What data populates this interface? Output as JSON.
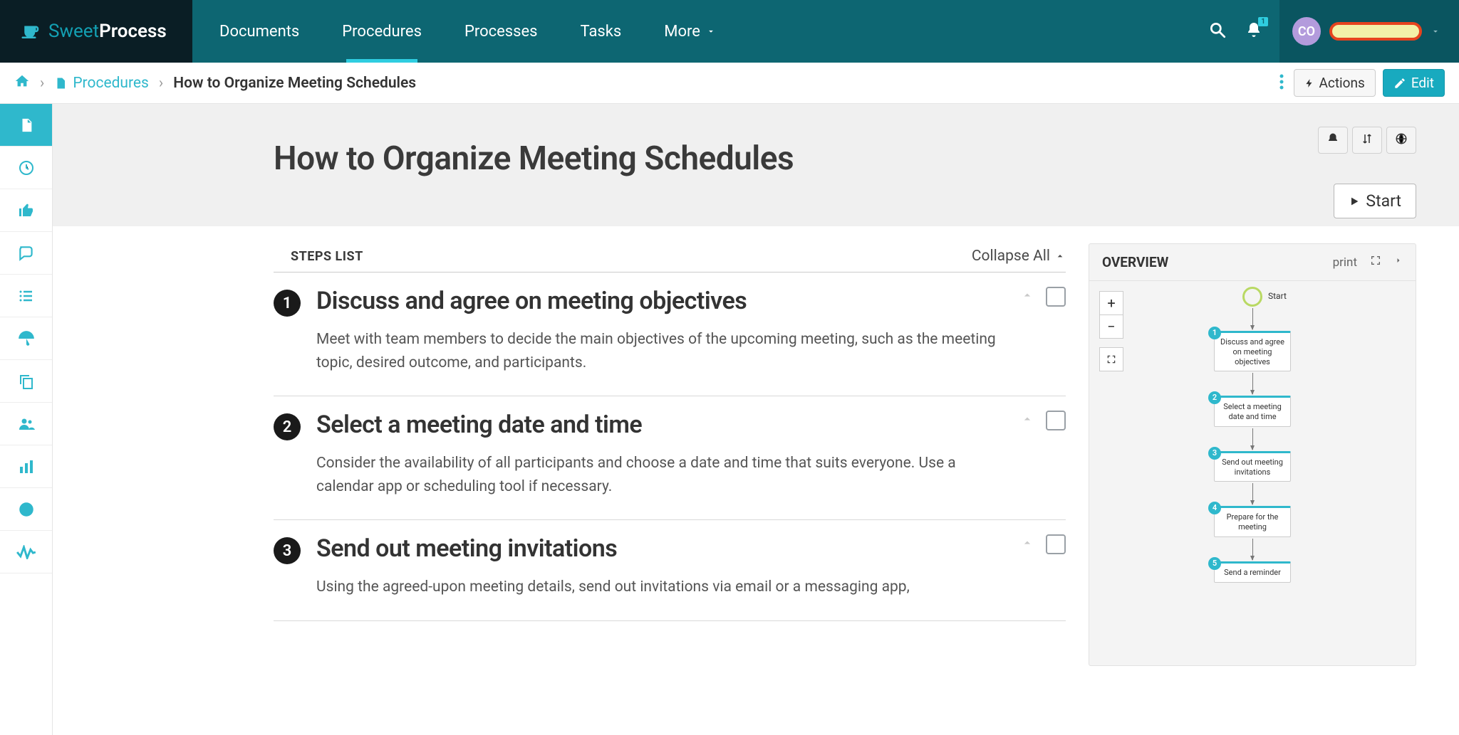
{
  "brand": {
    "name_light": "Sweet",
    "name_bold": "Process"
  },
  "nav": {
    "items": [
      {
        "label": "Documents",
        "active": false
      },
      {
        "label": "Procedures",
        "active": true
      },
      {
        "label": "Processes",
        "active": false
      },
      {
        "label": "Tasks",
        "active": false
      }
    ],
    "more": "More",
    "notification_badge": "1",
    "user_initials": "CO"
  },
  "breadcrumb": {
    "link": "Procedures",
    "current": "How to Organize Meeting Schedules"
  },
  "subheader_buttons": {
    "actions": "Actions",
    "edit": "Edit"
  },
  "hero": {
    "title": "How to Organize Meeting Schedules",
    "start": "Start"
  },
  "steps_panel": {
    "title": "STEPS LIST",
    "collapse": "Collapse All"
  },
  "steps": [
    {
      "num": "1",
      "title": "Discuss and agree on meeting objectives",
      "desc": "Meet with team members to decide the main objectives of the upcoming meeting, such as the meeting topic, desired outcome, and participants."
    },
    {
      "num": "2",
      "title": "Select a meeting date and time",
      "desc": "Consider the availability of all participants and choose a date and time that suits everyone. Use a calendar app or scheduling tool if necessary."
    },
    {
      "num": "3",
      "title": "Send out meeting invitations",
      "desc": "Using the agreed-upon meeting details, send out invitations via email or a messaging app,"
    }
  ],
  "overview": {
    "title": "OVERVIEW",
    "print": "print",
    "start_label": "Start",
    "nodes": [
      {
        "n": "1",
        "label": "Discuss and agree on meeting objectives"
      },
      {
        "n": "2",
        "label": "Select a meeting date and time"
      },
      {
        "n": "3",
        "label": "Send out meeting invitations"
      },
      {
        "n": "4",
        "label": "Prepare for the meeting"
      },
      {
        "n": "5",
        "label": "Send a reminder"
      }
    ]
  }
}
